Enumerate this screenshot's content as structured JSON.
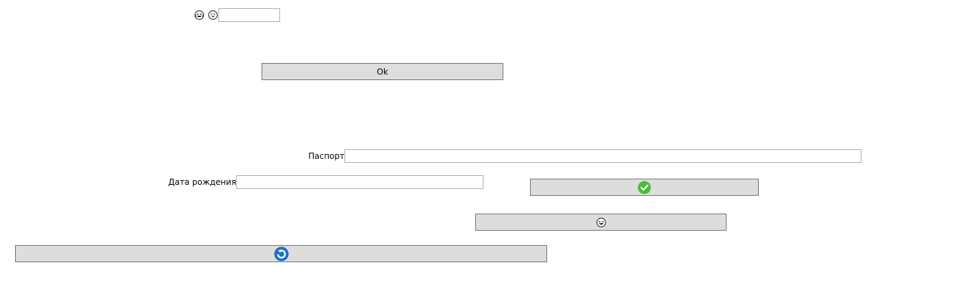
{
  "top_row": {
    "icons": [
      "laughing-face-icon",
      "grinning-face-icon"
    ],
    "input_value": ""
  },
  "ok_button": {
    "label": "Ok"
  },
  "passport": {
    "label": "Паспорт",
    "value": ""
  },
  "birth_date": {
    "label": "Дата рождения",
    "value": ""
  },
  "icon_buttons": {
    "confirm_icon": "check-circle-icon",
    "confirm_color": "#4cbb3a",
    "emoji_icon": "laughing-face-icon",
    "refresh_icon": "refresh-arrow-icon",
    "refresh_color": "#1a73c8"
  },
  "colors": {
    "button_face": "#dddddd",
    "button_border": "#707070",
    "input_border": "#ababab"
  }
}
